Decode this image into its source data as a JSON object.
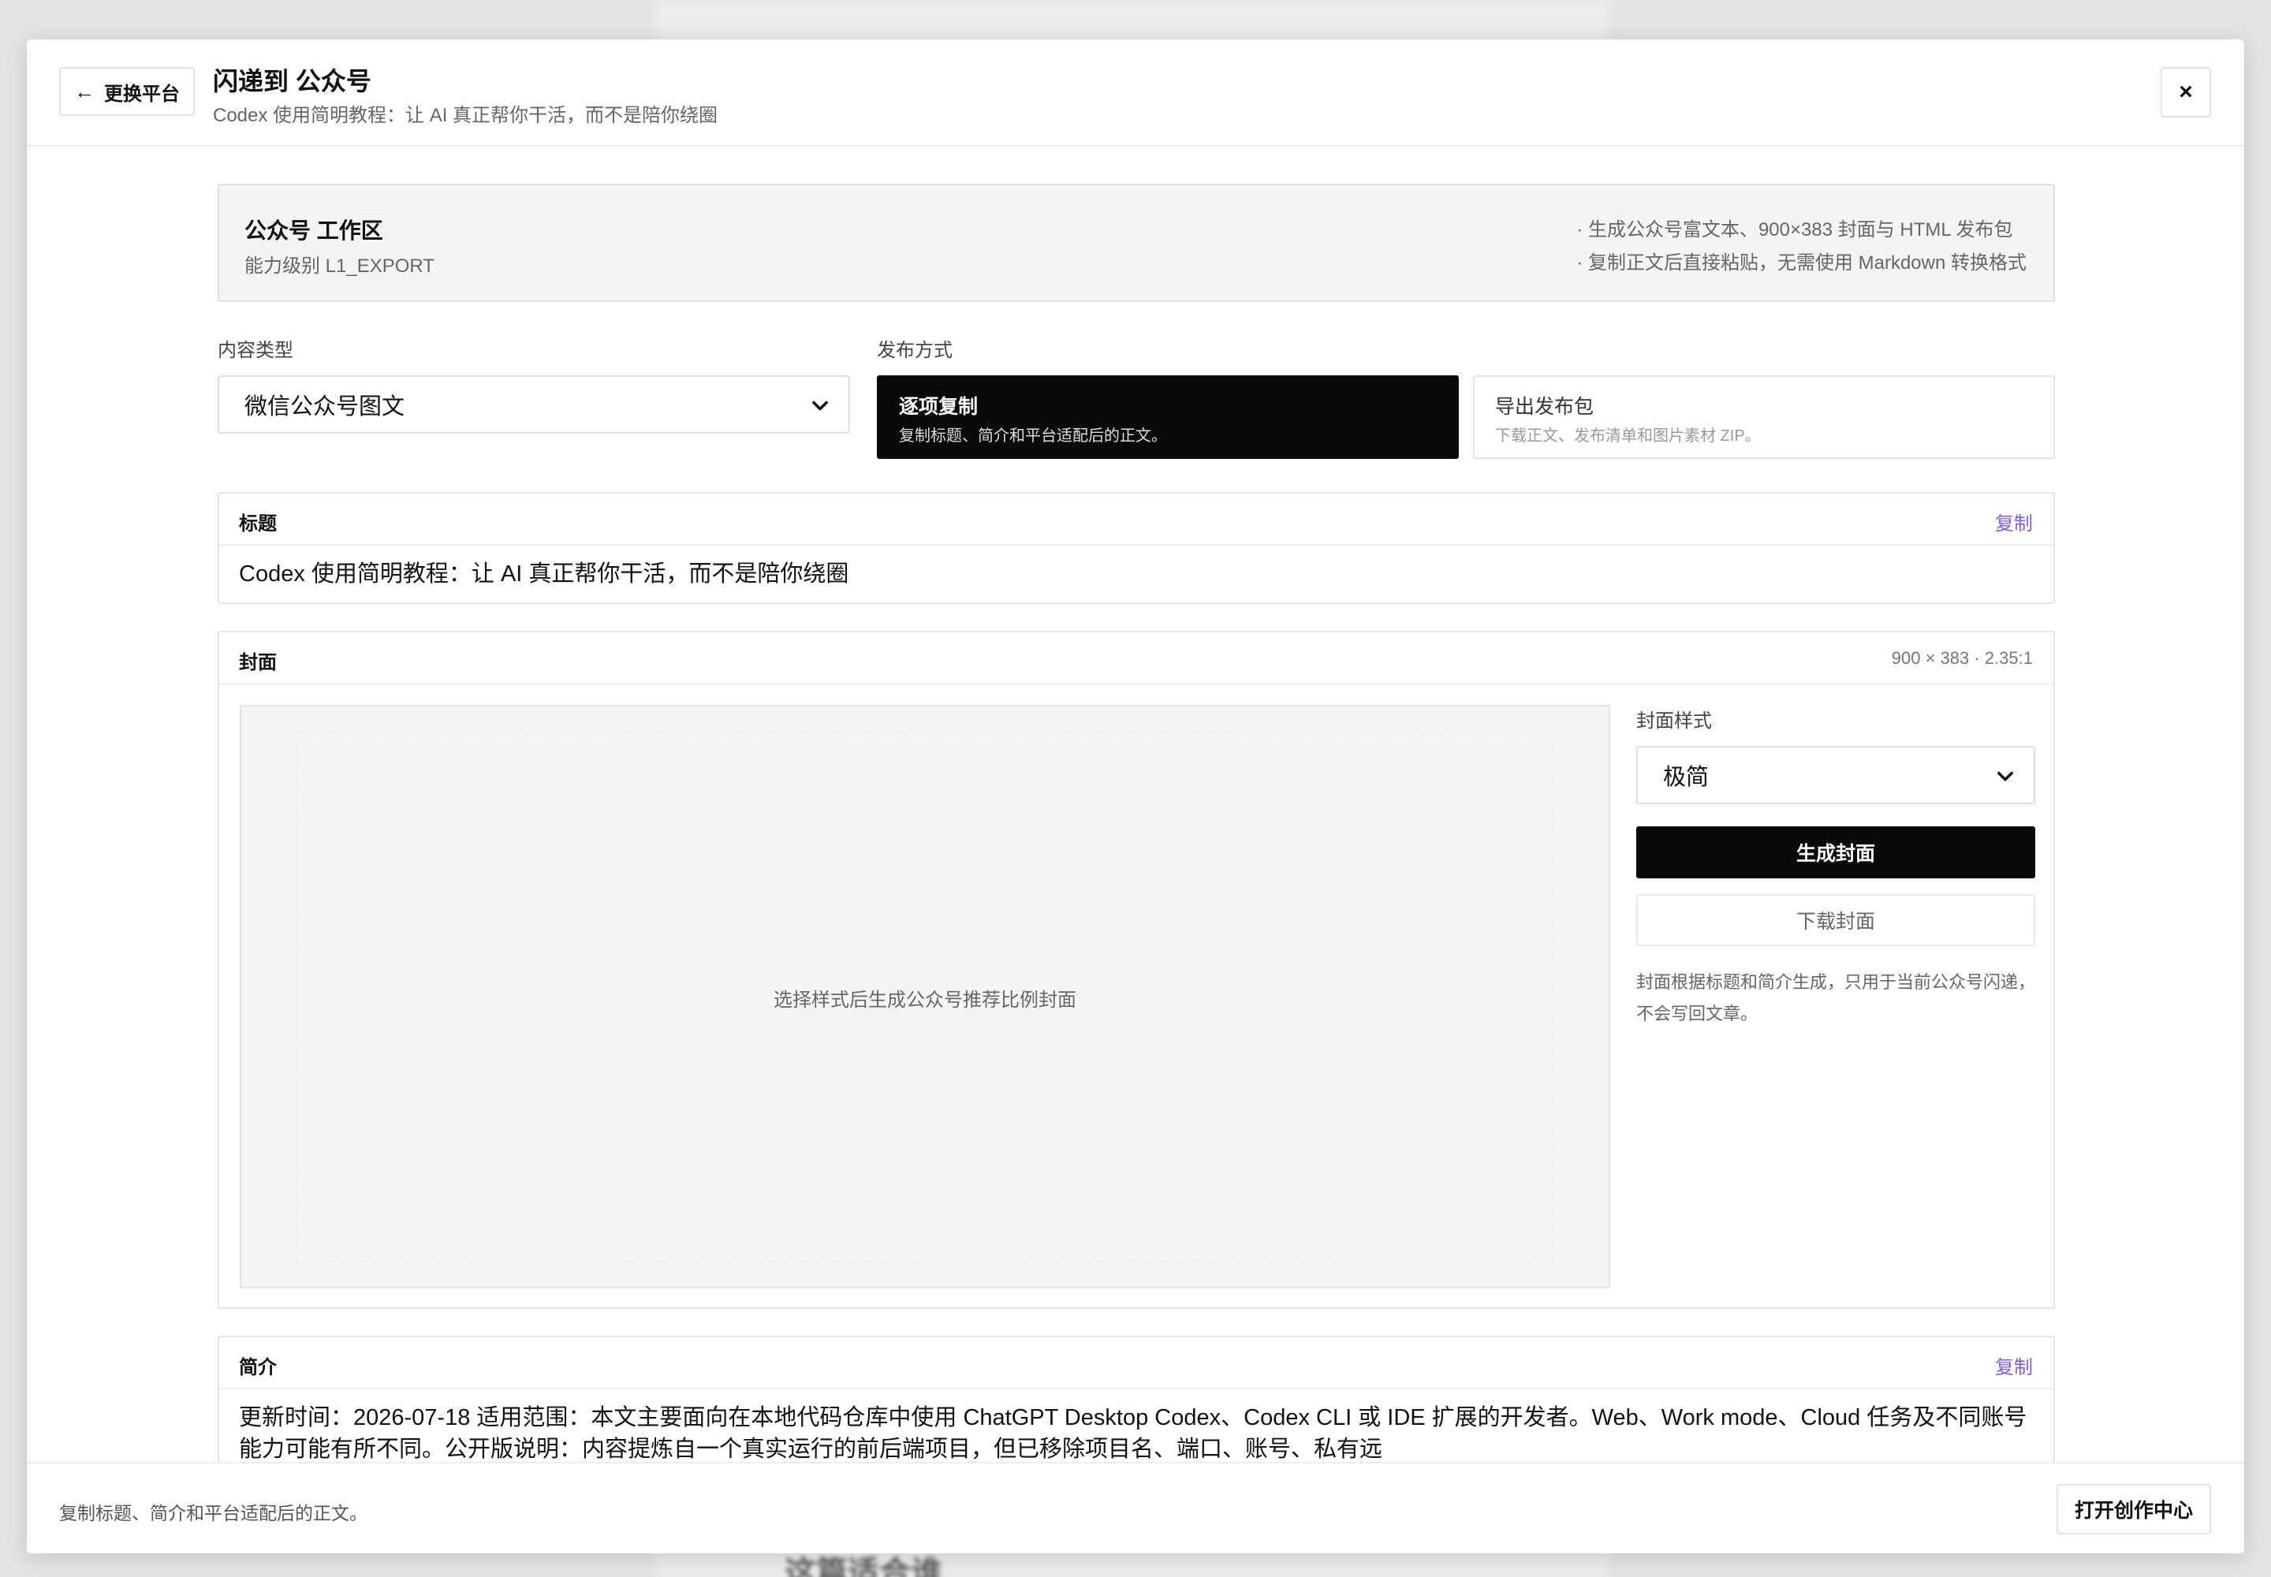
{
  "backdrop": {
    "text": "这篇适合谁"
  },
  "header": {
    "back_label": "更换平台",
    "title": "闪递到 公众号",
    "subtitle": "Codex 使用简明教程：让 AI 真正帮你干活，而不是陪你绕圈",
    "close_label": "×"
  },
  "workspace": {
    "title": "公众号 工作区",
    "level": "能力级别 L1_EXPORT",
    "notes": [
      "· 生成公众号富文本、900×383 封面与 HTML 发布包",
      "· 复制正文后直接粘贴，无需使用 Markdown 转换格式"
    ]
  },
  "content_type": {
    "label": "内容类型",
    "selected": "微信公众号图文"
  },
  "publish": {
    "label": "发布方式",
    "options": [
      {
        "title": "逐项复制",
        "desc": "复制标题、简介和平台适配后的正文。",
        "active": true
      },
      {
        "title": "导出发布包",
        "desc": "下载正文、发布清单和图片素材 ZIP。",
        "active": false
      }
    ]
  },
  "title_panel": {
    "label": "标题",
    "copy_label": "复制",
    "value": "Codex 使用简明教程：让 AI 真正帮你干活，而不是陪你绕圈"
  },
  "cover_panel": {
    "label": "封面",
    "meta": "900 × 383 · 2.35:1",
    "placeholder": "选择样式后生成公众号推荐比例封面",
    "style_label": "封面样式",
    "style_selected": "极简",
    "generate_label": "生成封面",
    "download_label": "下载封面",
    "note": "封面根据标题和简介生成，只用于当前公众号闪递，不会写回文章。"
  },
  "summary_panel": {
    "label": "简介",
    "copy_label": "复制",
    "value": "更新时间：2026-07-18 适用范围：本文主要面向在本地代码仓库中使用 ChatGPT Desktop Codex、Codex CLI 或 IDE 扩展的开发者。Web、Work mode、Cloud 任务及不同账号能力可能有所不同。公开版说明：内容提炼自一个真实运行的前后端项目，但已移除项目名、端口、账号、私有远"
  },
  "footer": {
    "text": "复制标题、简介和平台适配后的正文。",
    "button_label": "打开创作中心"
  },
  "colors": {
    "accent": "#7c5ce6",
    "primary_button": "#0a0a0a",
    "panel_bg": "#f4f4f4"
  }
}
